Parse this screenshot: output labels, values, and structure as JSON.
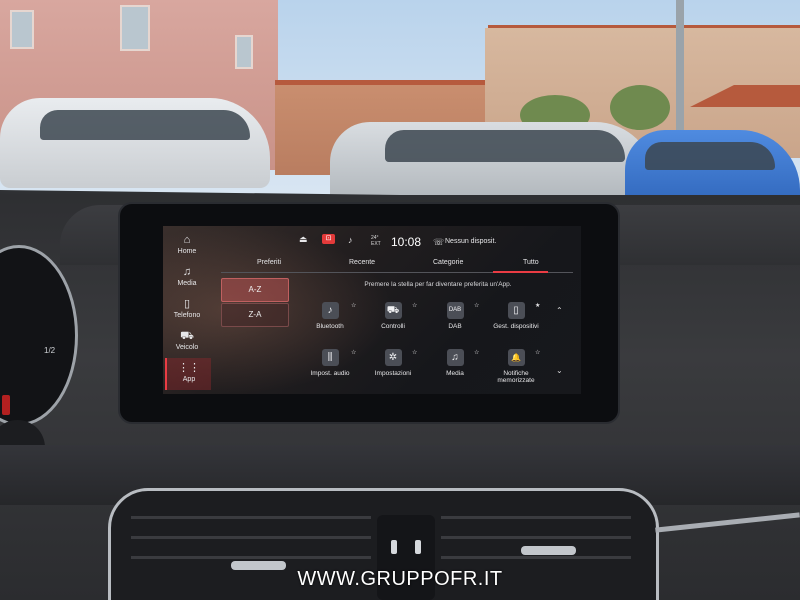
{
  "status_bar": {
    "temp_value": "24°",
    "temp_label": "EXT",
    "time": "10:08",
    "bluetooth_status": "Nessun disposit."
  },
  "sidebar": {
    "items": [
      {
        "label": "Home",
        "icon": "home-icon",
        "glyph": "⌂"
      },
      {
        "label": "Media",
        "icon": "music-icon",
        "glyph": "♫"
      },
      {
        "label": "Telefono",
        "icon": "phone-icon",
        "glyph": "▯"
      },
      {
        "label": "Veicolo",
        "icon": "car-icon",
        "glyph": "⛟"
      },
      {
        "label": "App",
        "icon": "apps-grid-icon",
        "glyph": "⋮⋮"
      }
    ],
    "active": "App"
  },
  "tabs": [
    {
      "label": "Preferiti"
    },
    {
      "label": "Recente"
    },
    {
      "label": "Categorie"
    },
    {
      "label": "Tutto"
    }
  ],
  "active_tab": "Tutto",
  "sort": {
    "az": "A-Z",
    "za": "Z-A"
  },
  "hint": "Premere la stella per far diventare preferita un'App.",
  "apps": [
    {
      "label": "Bluetooth",
      "icon": "bluetooth-music-icon",
      "glyph": "♪"
    },
    {
      "label": "Controlli",
      "icon": "car-controls-icon",
      "glyph": "⛟"
    },
    {
      "label": "DAB",
      "icon": "dab-radio-icon",
      "glyph": "DAB"
    },
    {
      "label": "Gest. dispositivi",
      "icon": "device-manager-icon",
      "glyph": "▯"
    },
    {
      "label": "Impost. audio",
      "icon": "equalizer-icon",
      "glyph": "⫼"
    },
    {
      "label": "Impostazioni",
      "icon": "gear-icon",
      "glyph": "✲"
    },
    {
      "label": "Media",
      "icon": "music-note-icon",
      "glyph": "♫"
    },
    {
      "label": "Notifiche memorizzate",
      "icon": "bell-icon",
      "glyph": "🔔"
    }
  ],
  "watermark": "WWW.GRUPPOFR.IT",
  "colors": {
    "accent": "#ea3c44",
    "screen_bg": "#17181c"
  }
}
